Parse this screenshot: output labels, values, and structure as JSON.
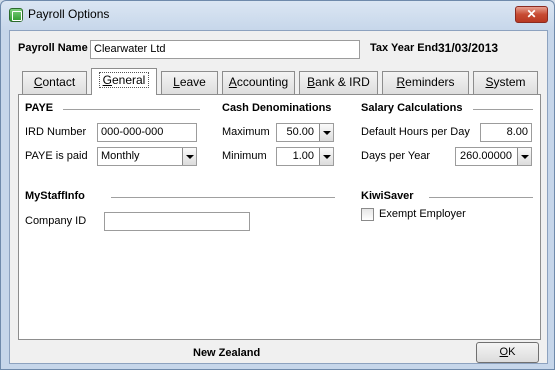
{
  "window": {
    "title": "Payroll Options",
    "close_symbol": "✕"
  },
  "header": {
    "payroll_name_label": "Payroll Name",
    "payroll_name_value": "Clearwater Ltd",
    "tax_year_end_label": "Tax Year End",
    "tax_year_end_value": "31/03/2013"
  },
  "tabs": [
    {
      "key": "C",
      "rest": "ontact",
      "active": false
    },
    {
      "key": "G",
      "rest": "eneral",
      "active": true
    },
    {
      "key": "L",
      "rest": "eave",
      "active": false
    },
    {
      "key": "A",
      "rest": "ccounting",
      "active": false
    },
    {
      "key": "B",
      "rest": "ank & IRD",
      "active": false
    },
    {
      "key": "R",
      "rest": "eminders",
      "active": false
    },
    {
      "key": "S",
      "rest": "ystem",
      "active": false
    }
  ],
  "paye": {
    "heading": "PAYE",
    "ird_number_label": "IRD Number",
    "ird_number_value": "000-000-000",
    "paye_paid_label": "PAYE is paid",
    "paye_paid_value": "Monthly"
  },
  "cash": {
    "heading": "Cash Denominations",
    "maximum_label": "Maximum",
    "maximum_value": "50.00",
    "minimum_label": "Minimum",
    "minimum_value": "1.00"
  },
  "salary": {
    "heading": "Salary Calculations",
    "hours_label": "Default Hours per Day",
    "hours_value": "8.00",
    "days_label": "Days per Year",
    "days_value": "260.00000"
  },
  "mystaffinfo": {
    "heading": "MyStaffInfo",
    "company_id_label": "Company ID",
    "company_id_value": ""
  },
  "kiwisaver": {
    "heading": "KiwiSaver",
    "exempt_label": "Exempt Employer",
    "exempt_checked": false
  },
  "footer": {
    "country": "New Zealand",
    "ok_key": "O",
    "ok_rest": "K"
  }
}
